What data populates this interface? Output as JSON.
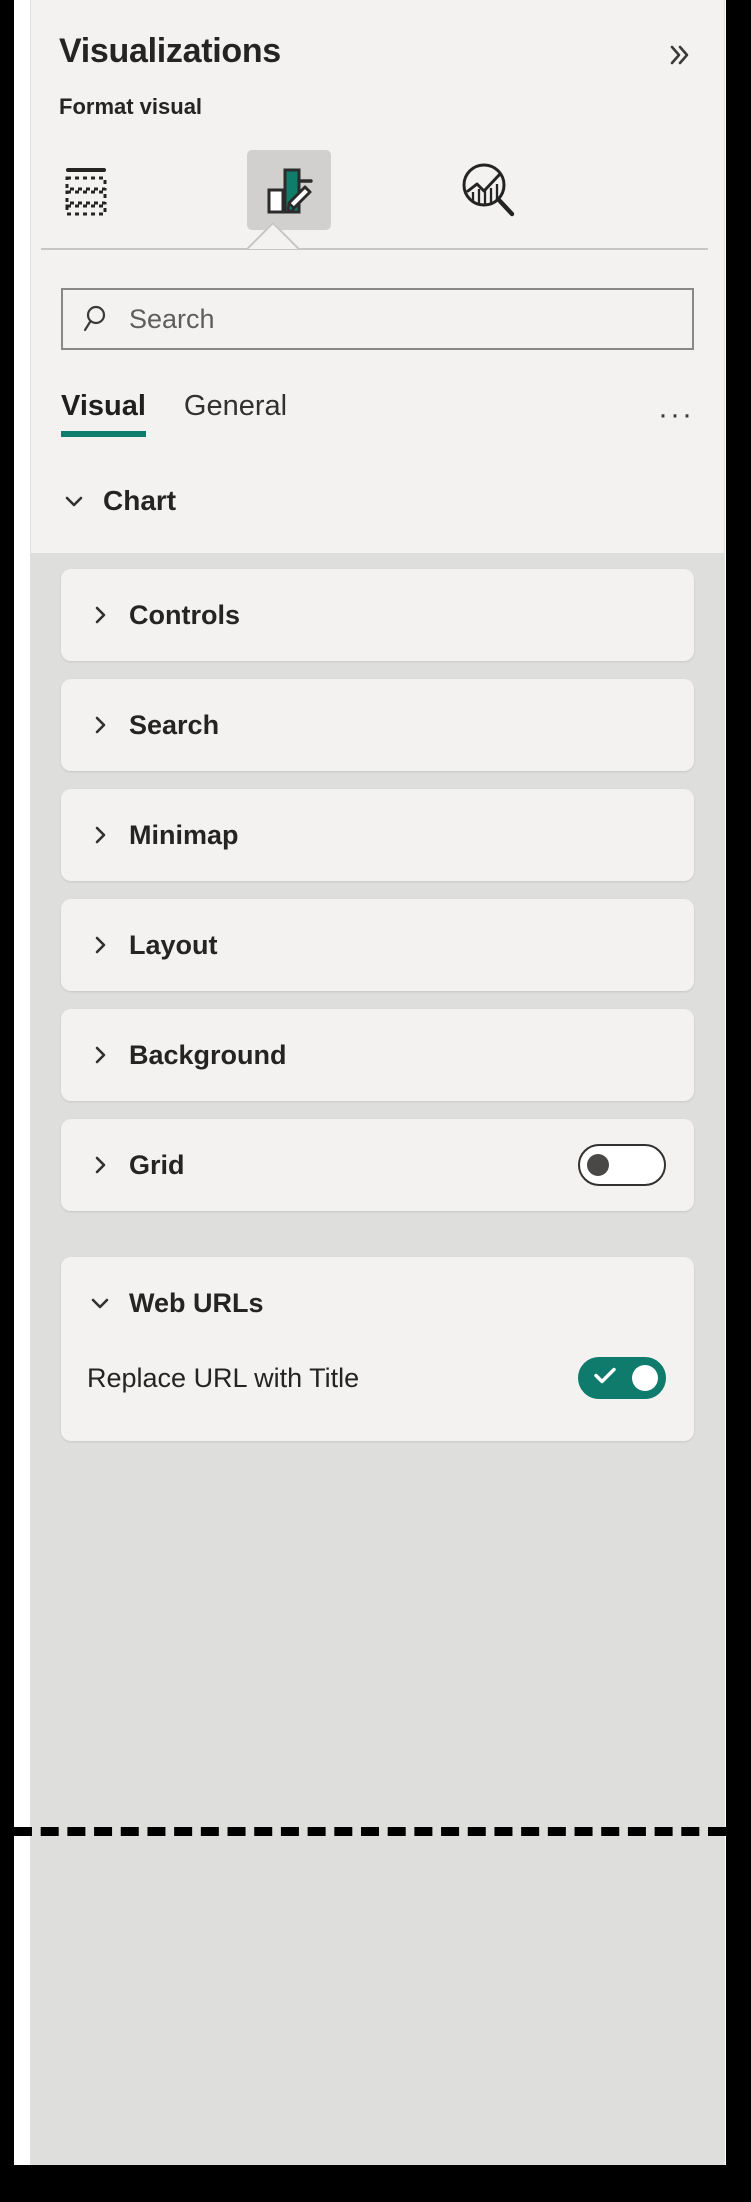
{
  "panel": {
    "title": "Visualizations",
    "subtitle": "Format visual",
    "collapse_icon": "double-chevron-right-icon",
    "accent_color": "#0f7b6c"
  },
  "icon_tabs": [
    {
      "name": "build-visual-icon",
      "label": "Build visual",
      "selected": false
    },
    {
      "name": "format-visual-icon",
      "label": "Format visual",
      "selected": true
    },
    {
      "name": "analytics-icon",
      "label": "Analytics",
      "selected": false
    }
  ],
  "search": {
    "placeholder": "Search",
    "value": "",
    "icon": "search-icon"
  },
  "tabs": {
    "items": [
      {
        "label": "Visual",
        "active": true
      },
      {
        "label": "General",
        "active": false
      }
    ],
    "more_label": "···"
  },
  "group": {
    "label": "Chart",
    "expanded": true,
    "chevron": "chevron-down-icon"
  },
  "cards": [
    {
      "label": "Controls",
      "expanded": false,
      "chevron": "chevron-right-icon",
      "toggle": null
    },
    {
      "label": "Search",
      "expanded": false,
      "chevron": "chevron-right-icon",
      "toggle": null
    },
    {
      "label": "Minimap",
      "expanded": false,
      "chevron": "chevron-right-icon",
      "toggle": null
    },
    {
      "label": "Layout",
      "expanded": false,
      "chevron": "chevron-right-icon",
      "toggle": null
    },
    {
      "label": "Background",
      "expanded": false,
      "chevron": "chevron-right-icon",
      "toggle": null
    },
    {
      "label": "Grid",
      "expanded": false,
      "chevron": "chevron-right-icon",
      "toggle": "off"
    }
  ],
  "web_urls": {
    "label": "Web URLs",
    "expanded": true,
    "chevron": "chevron-down-icon",
    "properties": [
      {
        "label": "Replace URL with Title",
        "toggle": "on"
      }
    ]
  }
}
